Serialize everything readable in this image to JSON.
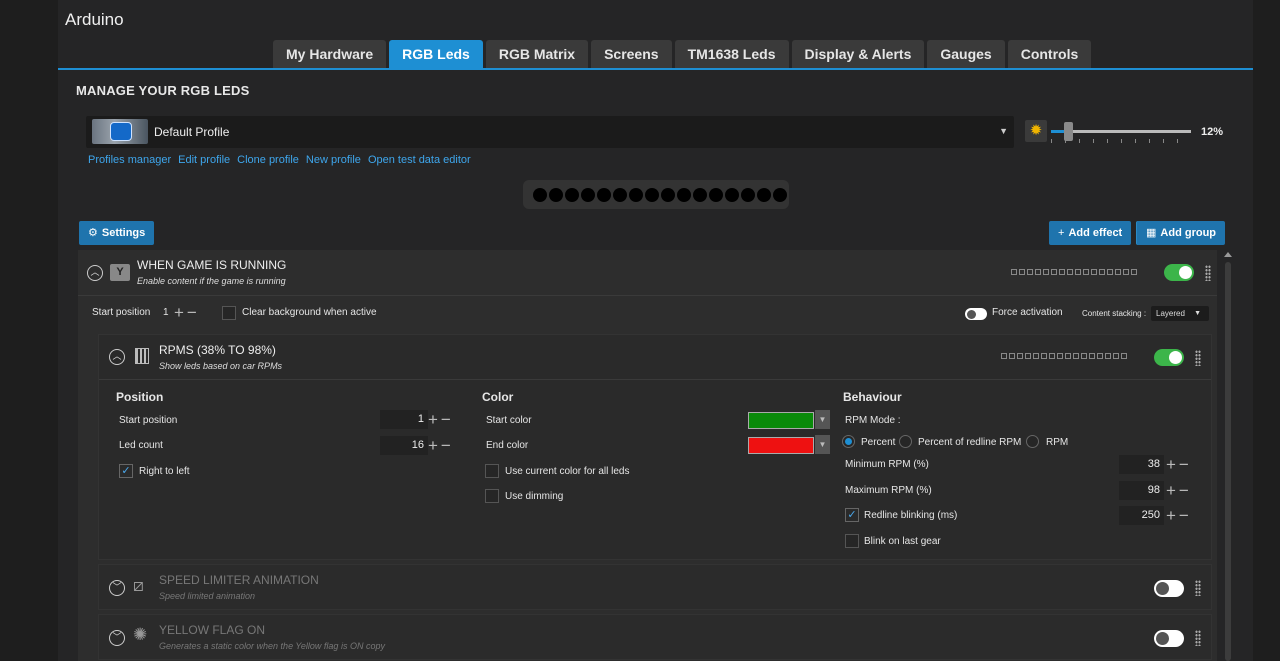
{
  "app": {
    "title": "Arduino"
  },
  "tabs": [
    {
      "label": "My Hardware"
    },
    {
      "label": "RGB Leds"
    },
    {
      "label": "RGB Matrix"
    },
    {
      "label": "Screens"
    },
    {
      "label": "TM1638 Leds"
    },
    {
      "label": "Display & Alerts"
    },
    {
      "label": "Gauges"
    },
    {
      "label": "Controls"
    }
  ],
  "active_tab": "RGB Leds",
  "section_title": "MANAGE YOUR RGB LEDS",
  "profile": {
    "name": "Default Profile"
  },
  "brightness": {
    "value": 12,
    "label": "12%"
  },
  "links": [
    "Profiles manager",
    "Edit profile",
    "Clone profile",
    "New profile",
    "Open test data editor"
  ],
  "led_preview": {
    "count": 16,
    "color": "#000000"
  },
  "buttons": {
    "settings": "Settings",
    "add_effect": "Add effect",
    "add_group": "Add group"
  },
  "group": {
    "title": "WHEN GAME IS RUNNING",
    "subtitle": "Enable content if the game is running",
    "enabled": true,
    "start_position_label": "Start position",
    "start_position": "1",
    "clear_bg_label": "Clear background when active",
    "force_activation_label": "Force activation",
    "content_stacking_label": "Content stacking :",
    "content_stacking_value": "Layered"
  },
  "rpms": {
    "title": "RPMS (38% TO 98%)",
    "subtitle": "Show leds based on car RPMs",
    "enabled": true,
    "position": {
      "header": "Position",
      "start_position_label": "Start position",
      "start_position": "1",
      "led_count_label": "Led count",
      "led_count": "16",
      "right_to_left_label": "Right to left",
      "right_to_left": true
    },
    "color": {
      "header": "Color",
      "start_color_label": "Start color",
      "start_color": "#0a8a0a",
      "end_color_label": "End color",
      "end_color": "#ee1111",
      "use_current_label": "Use current color for all leds",
      "use_dimming_label": "Use dimming"
    },
    "behaviour": {
      "header": "Behaviour",
      "rpm_mode_label": "RPM Mode :",
      "modes": [
        "Percent",
        "Percent of redline RPM",
        "RPM"
      ],
      "selected_mode": "Percent",
      "min_rpm_label": "Minimum RPM (%)",
      "min_rpm": "38",
      "max_rpm_label": "Maximum RPM (%)",
      "max_rpm": "98",
      "redline_label": "Redline blinking (ms)",
      "redline": "250",
      "redline_checked": true,
      "blink_last_gear_label": "Blink on last gear"
    }
  },
  "effects": [
    {
      "title": "SPEED LIMITER ANIMATION",
      "subtitle": "Speed limited animation",
      "enabled": false
    },
    {
      "title": "YELLOW FLAG ON",
      "subtitle": "Generates a static color when the Yellow flag is ON copy",
      "enabled": false
    }
  ],
  "colors": {
    "accent": "#1e8fd3",
    "toggle_on": "#3cb54a",
    "link": "#3ea6ec"
  }
}
